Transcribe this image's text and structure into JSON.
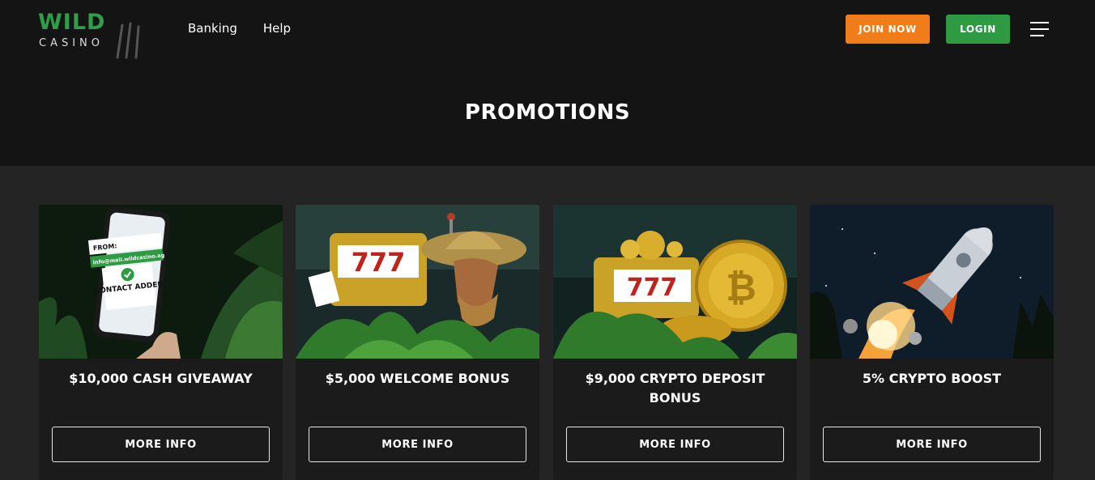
{
  "brand": {
    "logo_word": "WILD",
    "logo_sub": "CASINO",
    "color": "#2f9e4a"
  },
  "nav": {
    "items": [
      {
        "label": "Banking"
      },
      {
        "label": "Help"
      }
    ]
  },
  "header": {
    "join_label": "JOIN NOW",
    "login_label": "LOGIN",
    "join_color": "#f07c1a",
    "login_color": "#2e9b43"
  },
  "main": {
    "title": "PROMOTIONS",
    "cards": [
      {
        "title": "$10,000 CASH GIVEAWAY",
        "button": "MORE INFO",
        "image": {
          "from": "FROM:",
          "email": "info@mail.wildcasino.ag",
          "badge": "CONTACT ADDED"
        }
      },
      {
        "title": "$5,000 WELCOME BONUS",
        "button": "MORE INFO",
        "image": {
          "reels": "777"
        }
      },
      {
        "title": "$9,000 CRYPTO DEPOSIT BONUS",
        "button": "MORE INFO",
        "image": {
          "reels": "777"
        }
      },
      {
        "title": "5% CRYPTO BOOST",
        "button": "MORE INFO"
      }
    ]
  }
}
